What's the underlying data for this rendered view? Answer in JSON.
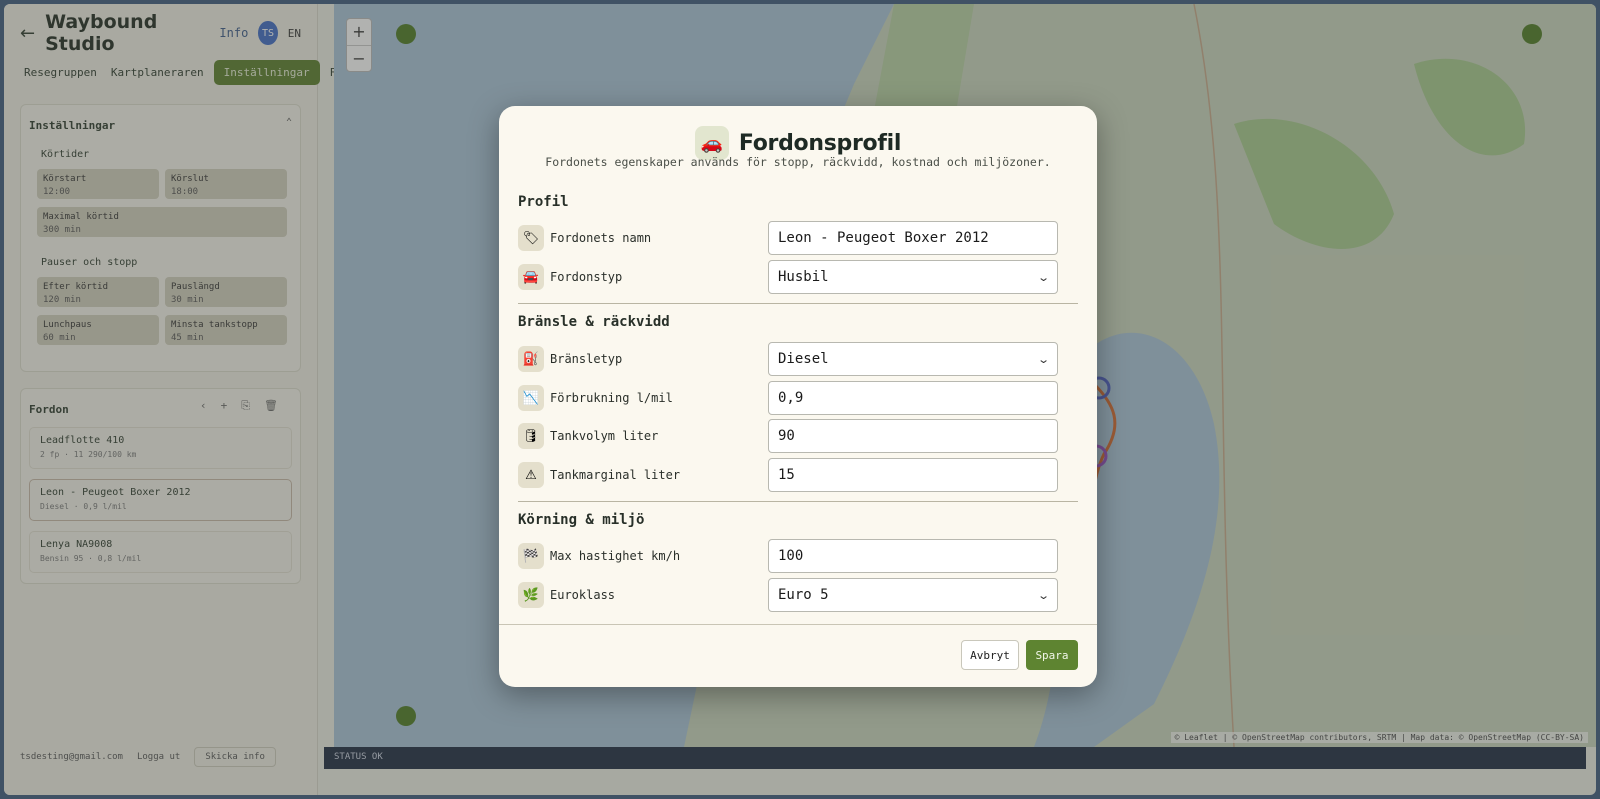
{
  "app": {
    "brand": "Waybound Studio",
    "back_icon": "arrow-left-icon",
    "info_label": "Info",
    "avatar_label": "TS",
    "lang_label": "EN",
    "tabs": [
      "Resegruppen",
      "Kartplaneraren",
      "Inställningar",
      "Fordon"
    ],
    "active_tab": 2
  },
  "settings_panel": {
    "title": "Inställningar",
    "collapse_icon": "chevron-up-icon",
    "groups": [
      {
        "title": "Körtider",
        "fields": [
          {
            "label": "Körstart",
            "value": "12:00"
          },
          {
            "label": "Körslut",
            "value": "18:00"
          },
          {
            "label": "Maximal körtid",
            "value": "300 min"
          }
        ]
      },
      {
        "title": "Pauser och stopp",
        "fields": [
          {
            "label": "Efter körtid",
            "value": "120 min"
          },
          {
            "label": "Pauslängd",
            "value": "30 min"
          },
          {
            "label": "Lunchpaus",
            "value": "60 min"
          },
          {
            "label": "Minsta tankstopp",
            "value": "45 min"
          }
        ]
      }
    ]
  },
  "vehicles_panel": {
    "title": "Fordon",
    "items": [
      {
        "name": "Leadflotte 410",
        "meta": "2 fp · 11 290/100 km"
      },
      {
        "name": "Leon - Peugeot Boxer 2012",
        "meta": "Diesel · 0,9 l/mil"
      },
      {
        "name": "Lenya NA9008",
        "meta": "Bensin 95 · 0,8 l/mil"
      }
    ]
  },
  "sidebar_footer": {
    "email": "tsdesting@gmail.com",
    "logout": "Logga ut",
    "submit": "Skicka info"
  },
  "map": {
    "zoom_in": "+",
    "zoom_out": "−",
    "attribution": "© Leaflet | © OpenStreetMap contributors, SRTM | Map data: © OpenStreetMap (CC-BY-SA)",
    "status": "STATUS OK"
  },
  "modal": {
    "emoji": "🚗",
    "title": "Fordonsprofil",
    "subtitle": "Fordonets egenskaper används för stopp, räckvidd, kostnad och miljözoner.",
    "sections": {
      "profil": "Profil",
      "fuel": "Bränsle & räckvidd",
      "driving": "Körning & miljö"
    },
    "fields": {
      "name": {
        "icon": "🏷",
        "label": "Fordonets namn",
        "value": "Leon - Peugeot Boxer 2012"
      },
      "type": {
        "icon": "🚘",
        "label": "Fordonstyp",
        "value": "Husbil"
      },
      "fuel_type": {
        "icon": "⛽",
        "label": "Bränsletyp",
        "value": "Diesel"
      },
      "consumption": {
        "icon": "📉",
        "label": "Förbrukning l/mil",
        "value": "0,9"
      },
      "tank": {
        "icon": "🛢",
        "label": "Tankvolym liter",
        "value": "90"
      },
      "margin": {
        "icon": "⚠",
        "label": "Tankmarginal liter",
        "value": "15"
      },
      "speed": {
        "icon": "🏁",
        "label": "Max hastighet km/h",
        "value": "100"
      },
      "euro": {
        "icon": "🌿",
        "label": "Euroklass",
        "value": "Euro 5"
      }
    },
    "cancel": "Avbryt",
    "save": "Spara"
  }
}
